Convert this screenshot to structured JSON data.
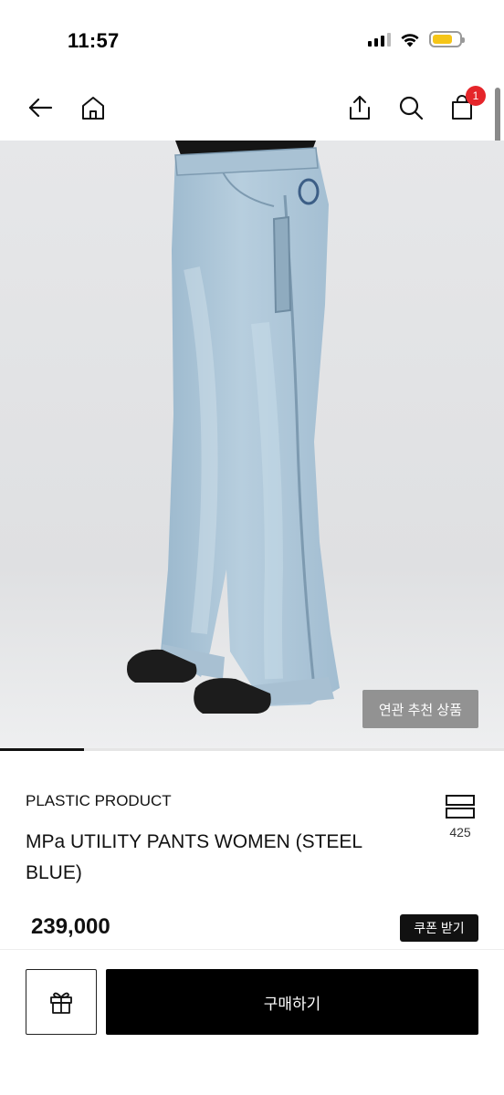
{
  "status_bar": {
    "time": "11:57",
    "battery_level": 0.75,
    "battery_color": "#f5c518"
  },
  "header": {
    "icons": [
      "back-arrow-icon",
      "home-icon",
      "share-icon",
      "search-icon",
      "cart-icon"
    ],
    "cart_badge": "1",
    "badge_color": "#e5252a"
  },
  "product_image": {
    "related_button_label": "연관 추천 상품",
    "gallery_progress": 0.166
  },
  "product": {
    "brand": "PLASTIC PRODUCT",
    "name": "MPa UTILITY PANTS WOMEN (STEEL BLUE)",
    "like_count": "425",
    "price": "239,000",
    "coupon_label": "쿠폰 받기"
  },
  "bottom_bar": {
    "gift_icon": "gift-icon",
    "buy_label": "구매하기"
  }
}
